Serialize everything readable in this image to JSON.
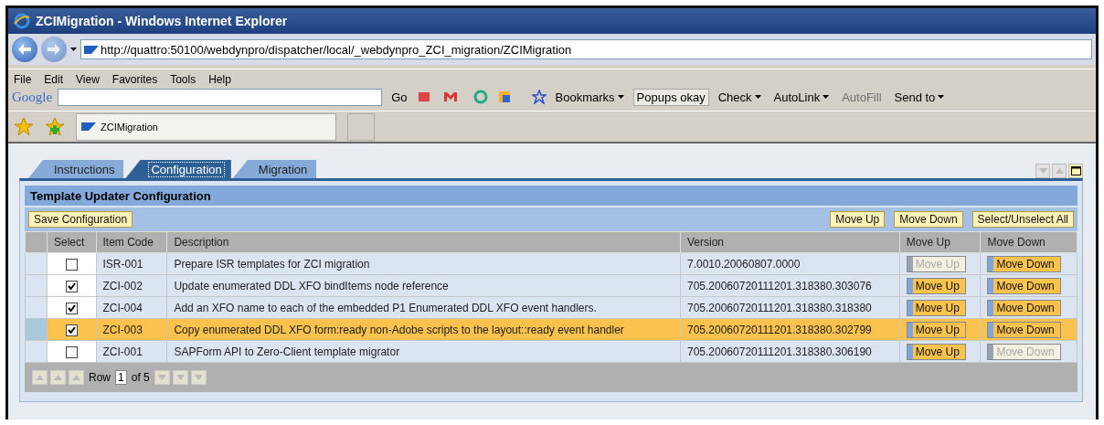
{
  "window": {
    "title": "ZCIMigration - Windows Internet Explorer"
  },
  "address_bar": {
    "url": "http://quattro:50100/webdynpro/dispatcher/local/_webdynpro_ZCI_migration/ZCIMigration"
  },
  "menu": [
    "File",
    "Edit",
    "View",
    "Favorites",
    "Tools",
    "Help"
  ],
  "google_toolbar": {
    "brand": "Google",
    "go": "Go",
    "items": [
      {
        "kind": "menu",
        "label": "Bookmarks",
        "disabled": false,
        "pressed": false
      },
      {
        "kind": "button",
        "label": "Popups okay",
        "disabled": false,
        "pressed": true
      },
      {
        "kind": "menu",
        "label": "Check",
        "disabled": false,
        "pressed": false
      },
      {
        "kind": "menu",
        "label": "AutoLink",
        "disabled": false,
        "pressed": false
      },
      {
        "kind": "button",
        "label": "AutoFill",
        "disabled": true,
        "pressed": false
      },
      {
        "kind": "menu",
        "label": "Send to",
        "disabled": false,
        "pressed": false
      }
    ]
  },
  "browser_tab": {
    "label": "ZCIMigration"
  },
  "tabs": [
    {
      "label": "Instructions",
      "selected": false
    },
    {
      "label": "Configuration",
      "selected": true
    },
    {
      "label": "Migration",
      "selected": false
    }
  ],
  "panel": {
    "title": "Template Updater Configuration",
    "save_button": "Save Configuration",
    "actions": [
      "Move Up",
      "Move Down",
      "Select/Unselect All"
    ],
    "columns": [
      "Select",
      "Item Code",
      "Description",
      "Version",
      "Move Up",
      "Move Down"
    ],
    "rows": [
      {
        "selected": false,
        "checked": false,
        "code": "ISR-001",
        "description": "Prepare ISR templates for ZCI migration",
        "version": "7.0010.20060807.0000",
        "move_up": {
          "label": "Move Up",
          "disabled": true
        },
        "move_down": {
          "label": "Move Down",
          "disabled": false
        }
      },
      {
        "selected": false,
        "checked": true,
        "code": "ZCI-002",
        "description": "Update enumerated DDL XFO bindItems node reference",
        "version": "705.20060720111201.318380.303076",
        "move_up": {
          "label": "Move Up",
          "disabled": false
        },
        "move_down": {
          "label": "Move Down",
          "disabled": false
        }
      },
      {
        "selected": false,
        "checked": true,
        "code": "ZCI-004",
        "description": "Add an XFO name to each of the embedded P1 Enumerated DDL XFO event handlers.",
        "version": "705.20060720111201.318380.318380",
        "move_up": {
          "label": "Move Up",
          "disabled": false
        },
        "move_down": {
          "label": "Move Down",
          "disabled": false
        }
      },
      {
        "selected": true,
        "checked": true,
        "code": "ZCI-003",
        "description": "Copy enumerated DDL XFO form:ready non-Adobe scripts to the layout::ready event handler",
        "version": "705.20060720111201.318380.302799",
        "move_up": {
          "label": "Move Up",
          "disabled": false
        },
        "move_down": {
          "label": "Move Down",
          "disabled": false
        }
      },
      {
        "selected": false,
        "checked": false,
        "code": "ZCI-001",
        "description": "SAPForm API to Zero-Client template migrator",
        "version": "705.20060720111201.318380.306190",
        "move_up": {
          "label": "Move Up",
          "disabled": false
        },
        "move_down": {
          "label": "Move Down",
          "disabled": true
        }
      }
    ],
    "pager": {
      "label": "Row",
      "value": "1",
      "total": "of 5"
    }
  }
}
